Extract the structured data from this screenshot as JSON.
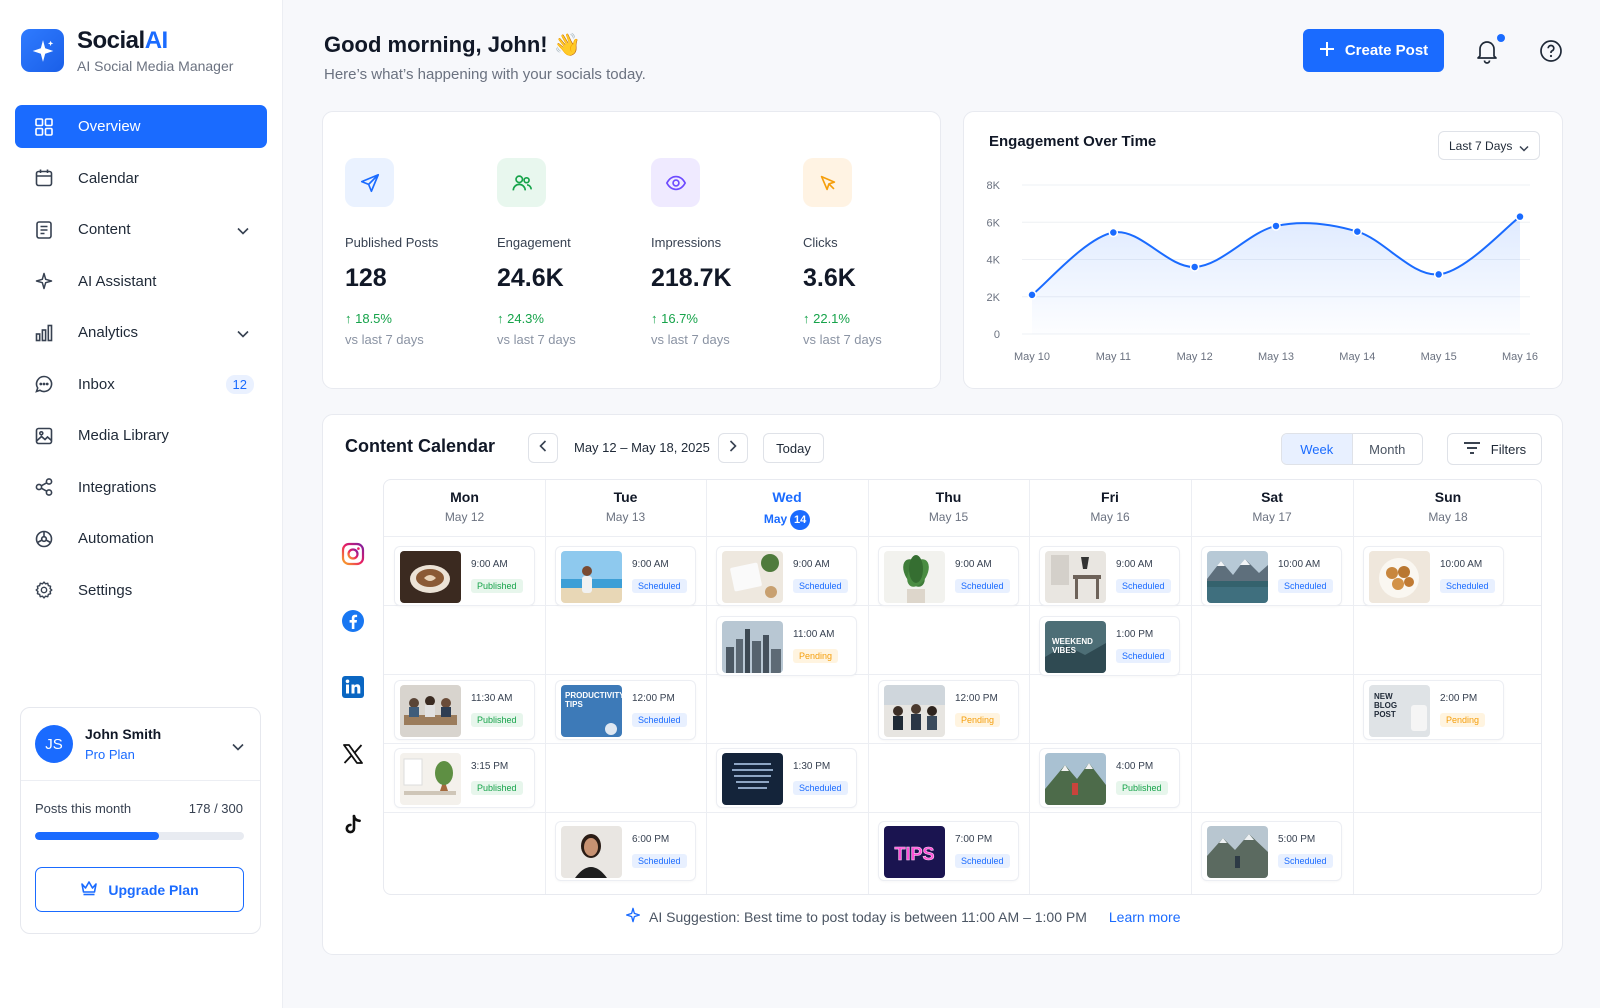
{
  "brand": {
    "name_main": "Social",
    "name_accent": "AI",
    "subtitle": "AI Social Media Manager"
  },
  "nav": [
    {
      "label": "Overview",
      "icon": "grid-icon",
      "active": true
    },
    {
      "label": "Calendar",
      "icon": "calendar-icon"
    },
    {
      "label": "Content",
      "icon": "document-icon",
      "has_chevron": true
    },
    {
      "label": "AI Assistant",
      "icon": "sparkle-icon"
    },
    {
      "label": "Analytics",
      "icon": "bar-chart-icon",
      "has_chevron": true
    },
    {
      "label": "Inbox",
      "icon": "chat-icon",
      "badge": "12"
    },
    {
      "label": "Media Library",
      "icon": "image-icon"
    },
    {
      "label": "Integrations",
      "icon": "share-nodes-icon"
    },
    {
      "label": "Automation",
      "icon": "automation-icon"
    },
    {
      "label": "Settings",
      "icon": "gear-icon"
    }
  ],
  "user": {
    "initials": "JS",
    "name": "John Smith",
    "plan": "Pro Plan",
    "posts_label": "Posts this month",
    "posts_used": "178",
    "posts_total": "300",
    "posts_fraction": 0.593,
    "upgrade_label": "Upgrade Plan"
  },
  "header": {
    "greeting": "Good morning, John! 👋",
    "subtitle": "Here’s what’s happening with your socials today.",
    "create_label": "Create Post"
  },
  "stats": [
    {
      "label": "Published Posts",
      "value": "128",
      "change": "↑ 18.5%",
      "vs": "vs last 7 days",
      "icon": "send-icon",
      "color": "#1a6bff",
      "bg": "#eaf2ff"
    },
    {
      "label": "Engagement",
      "value": "24.6K",
      "change": "↑ 24.3%",
      "vs": "vs last 7 days",
      "icon": "users-icon",
      "color": "#16a34a",
      "bg": "#e8f7ee"
    },
    {
      "label": "Impressions",
      "value": "218.7K",
      "change": "↑ 16.7%",
      "vs": "vs last 7 days",
      "icon": "eye-icon",
      "color": "#6d4aff",
      "bg": "#efeaff"
    },
    {
      "label": "Clicks",
      "value": "3.6K",
      "change": "↑ 22.1%",
      "vs": "vs last 7 days",
      "icon": "cursor-icon",
      "color": "#f59e0b",
      "bg": "#fff3e3"
    }
  ],
  "engagement": {
    "title": "Engagement Over Time",
    "range_label": "Last 7 Days",
    "chart_data": {
      "type": "line",
      "x": [
        "May 10",
        "May 11",
        "May 12",
        "May 13",
        "May 14",
        "May 15",
        "May 16"
      ],
      "values": [
        2100,
        5450,
        3600,
        5800,
        5500,
        3200,
        6300
      ],
      "ylim": [
        0,
        8000
      ],
      "yticks": [
        "0",
        "2K",
        "4K",
        "6K",
        "8K"
      ],
      "color": "#1a6bff"
    }
  },
  "calendar": {
    "title": "Content Calendar",
    "range": "May 12 – May 18, 2025",
    "today_label": "Today",
    "week_label": "Week",
    "month_label": "Month",
    "filters_label": "Filters",
    "days": [
      {
        "name": "Mon",
        "date": "May 12"
      },
      {
        "name": "Tue",
        "date": "May 13"
      },
      {
        "name": "Wed",
        "date": "May",
        "num": "14",
        "today": true
      },
      {
        "name": "Thu",
        "date": "May 15"
      },
      {
        "name": "Fri",
        "date": "May 16"
      },
      {
        "name": "Sat",
        "date": "May 17"
      },
      {
        "name": "Sun",
        "date": "May 18"
      }
    ],
    "platforms": [
      "instagram-icon",
      "facebook-icon",
      "linkedin-icon",
      "x-icon",
      "tiktok-icon"
    ],
    "posts": [
      {
        "day": 0,
        "row": 0,
        "time": "9:00 AM",
        "status": "Published",
        "thumb": "coffee"
      },
      {
        "day": 1,
        "row": 0,
        "time": "9:00 AM",
        "status": "Scheduled",
        "thumb": "beach"
      },
      {
        "day": 2,
        "row": 0,
        "time": "9:00 AM",
        "status": "Scheduled",
        "thumb": "desk"
      },
      {
        "day": 3,
        "row": 0,
        "time": "9:00 AM",
        "status": "Scheduled",
        "thumb": "plant"
      },
      {
        "day": 4,
        "row": 0,
        "time": "9:00 AM",
        "status": "Scheduled",
        "thumb": "interior"
      },
      {
        "day": 5,
        "row": 0,
        "time": "10:00 AM",
        "status": "Scheduled",
        "thumb": "lake"
      },
      {
        "day": 6,
        "row": 0,
        "time": "10:00 AM",
        "status": "Scheduled",
        "thumb": "food"
      },
      {
        "day": 2,
        "row": 1,
        "time": "11:00 AM",
        "status": "Pending",
        "thumb": "city"
      },
      {
        "day": 4,
        "row": 1,
        "time": "1:00 PM",
        "status": "Scheduled",
        "thumb": "weekend",
        "caption": "WEEKEND VIBES"
      },
      {
        "day": 0,
        "row": 2,
        "time": "11:30 AM",
        "status": "Published",
        "thumb": "meeting"
      },
      {
        "day": 1,
        "row": 2,
        "time": "12:00 PM",
        "status": "Scheduled",
        "thumb": "productivity",
        "caption": "PRODUCTIVITY TIPS"
      },
      {
        "day": 3,
        "row": 2,
        "time": "12:00 PM",
        "status": "Pending",
        "thumb": "office"
      },
      {
        "day": 6,
        "row": 2,
        "time": "2:00 PM",
        "status": "Pending",
        "thumb": "blog",
        "caption": "NEW BLOG POST"
      },
      {
        "day": 0,
        "row": 3,
        "time": "3:15 PM",
        "status": "Published",
        "thumb": "workspace"
      },
      {
        "day": 2,
        "row": 3,
        "time": "1:30 PM",
        "status": "Scheduled",
        "thumb": "dark"
      },
      {
        "day": 4,
        "row": 3,
        "time": "4:00 PM",
        "status": "Published",
        "thumb": "mountain"
      },
      {
        "day": 1,
        "row": 4,
        "time": "6:00 PM",
        "status": "Scheduled",
        "thumb": "person"
      },
      {
        "day": 3,
        "row": 4,
        "time": "7:00 PM",
        "status": "Scheduled",
        "thumb": "tips",
        "caption": "TIPS"
      },
      {
        "day": 5,
        "row": 4,
        "time": "5:00 PM",
        "status": "Scheduled",
        "thumb": "hiker"
      }
    ],
    "ai_suggestion": "AI Suggestion: Best time to post today is between 11:00 AM – 1:00 PM",
    "learn_more": "Learn more"
  }
}
